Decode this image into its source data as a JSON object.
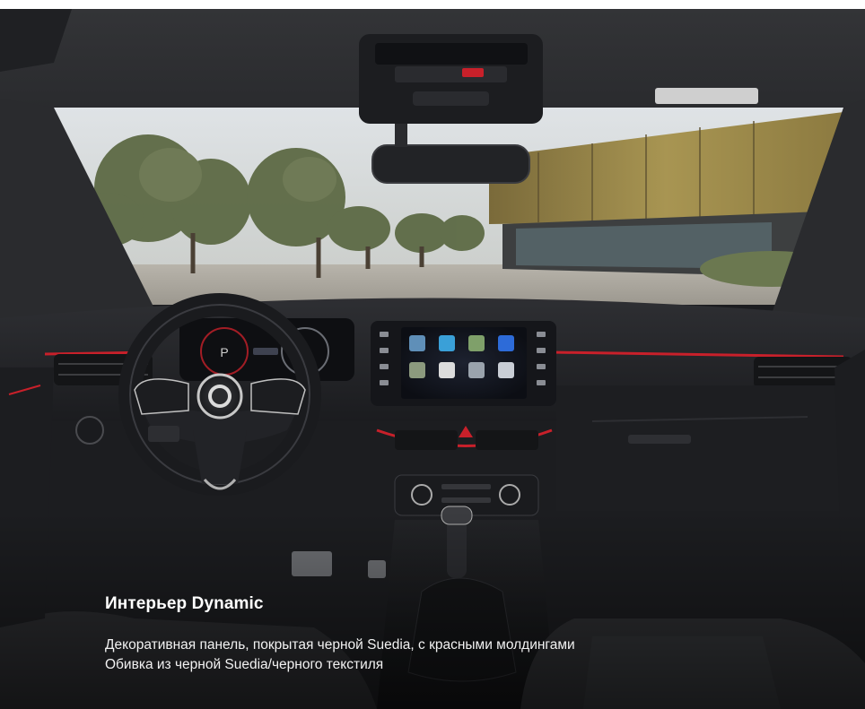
{
  "caption": {
    "title": "Интерьер Dynamic",
    "lines": [
      "Декоративная панель, покрытая черной Suedia, с красными молдингами",
      "Обивка из черной Suedia/черного текстиля"
    ]
  },
  "infotainment": {
    "apps": [
      "apps-tile-1",
      "apps-tile-2",
      "apps-tile-3",
      "apps-tile-4",
      "apps-tile-5",
      "apps-tile-6",
      "apps-tile-7",
      "apps-tile-8"
    ]
  },
  "cluster": {
    "gear": "P",
    "dial_right": "0"
  },
  "colors": {
    "trim_accent": "#c8202a",
    "dash": "#232428",
    "caption_text": "#ffffff"
  }
}
